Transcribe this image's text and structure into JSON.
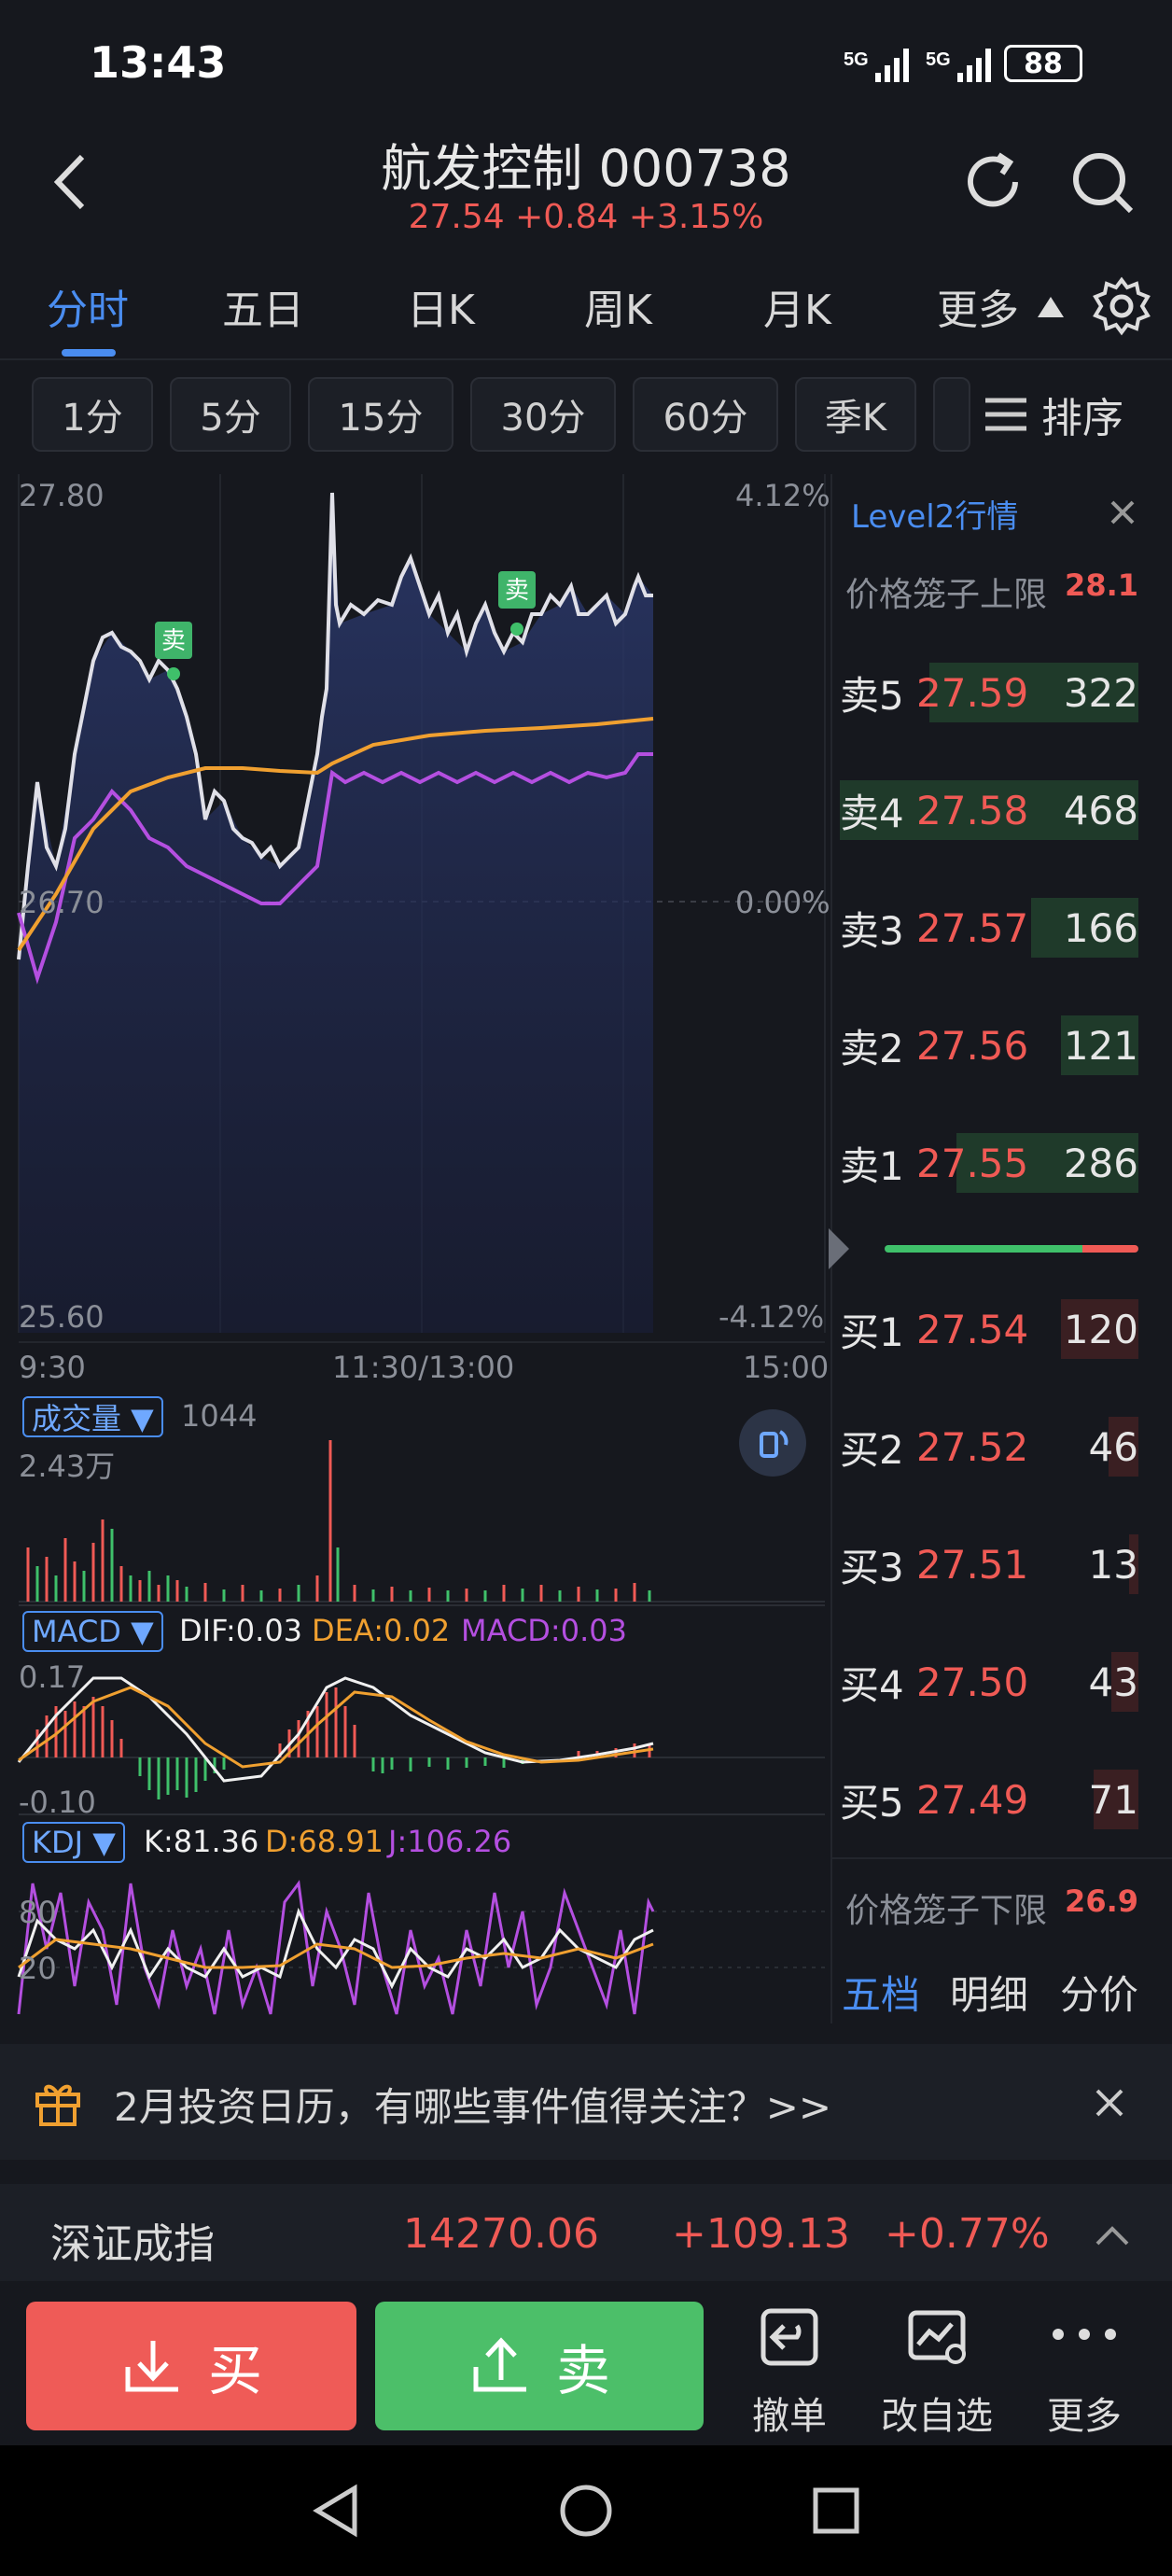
{
  "status_bar": {
    "time": "13:43",
    "signal1": "5G",
    "signal2": "5G",
    "battery": "88"
  },
  "header": {
    "title": "航发控制 000738",
    "price_line": "27.54 +0.84 +3.15%"
  },
  "period_tabs": [
    "分时",
    "五日",
    "日K",
    "周K",
    "月K",
    "更多"
  ],
  "interval_pills": [
    "1分",
    "5分",
    "15分",
    "30分",
    "60分",
    "季K"
  ],
  "sort_label": "排序",
  "chart_labels": {
    "price_high": "27.80",
    "pct_high": "4.12%",
    "price_mid": "26.70",
    "pct_mid": "0.00%",
    "price_low": "25.60",
    "pct_low": "-4.12%",
    "time_start": "9:30",
    "time_mid": "11:30/13:00",
    "time_end": "15:00",
    "sell_marker": "卖"
  },
  "volume": {
    "tag": "成交量 ▼",
    "value": "1044",
    "scale": "2.43万"
  },
  "macd": {
    "tag": "MACD ▼",
    "dif": "DIF:0.03",
    "dea": "DEA:0.02",
    "macd": "MACD:0.03",
    "top": "0.17",
    "bottom": "-0.10"
  },
  "kdj": {
    "tag": "KDJ ▼",
    "k": "K:81.36",
    "d": "D:68.91",
    "j": "J:106.26",
    "lvl80": "80",
    "lvl20": "20"
  },
  "level2": {
    "title": "Level2行情",
    "upper_label": "价格笼子上限",
    "upper_value": "28.1",
    "lower_label": "价格笼子下限",
    "lower_value": "26.9",
    "asks": [
      {
        "label": "卖5",
        "price": "27.59",
        "vol": "322",
        "fill": 0.7
      },
      {
        "label": "卖4",
        "price": "27.58",
        "vol": "468",
        "fill": 1.0
      },
      {
        "label": "卖3",
        "price": "27.57",
        "vol": "166",
        "fill": 0.36
      },
      {
        "label": "卖2",
        "price": "27.56",
        "vol": "121",
        "fill": 0.26
      },
      {
        "label": "卖1",
        "price": "27.55",
        "vol": "286",
        "fill": 0.61
      }
    ],
    "bids": [
      {
        "label": "买1",
        "price": "27.54",
        "vol": "120",
        "fill": 0.26
      },
      {
        "label": "买2",
        "price": "27.52",
        "vol": "46",
        "fill": 0.1
      },
      {
        "label": "买3",
        "price": "27.51",
        "vol": "13",
        "fill": 0.03
      },
      {
        "label": "买4",
        "price": "27.50",
        "vol": "43",
        "fill": 0.09
      },
      {
        "label": "买5",
        "price": "27.49",
        "vol": "71",
        "fill": 0.15
      }
    ],
    "tabs": [
      "五档",
      "明细",
      "分价"
    ]
  },
  "banner": {
    "text": "2月投资日历，有哪些事件值得关注？>>"
  },
  "index_bar": {
    "name": "深证成指",
    "value": "14270.06",
    "change": "+109.13",
    "pct": "+0.77%"
  },
  "actions": {
    "buy": "买",
    "sell": "卖",
    "cancel": "撤单",
    "edit_watch": "改自选",
    "more": "更多"
  },
  "colors": {
    "up": "#f05a55",
    "down": "#3fc06a",
    "accent": "#4a8df0",
    "avg_line": "#f0a030",
    "purple": "#b44fe0"
  }
}
